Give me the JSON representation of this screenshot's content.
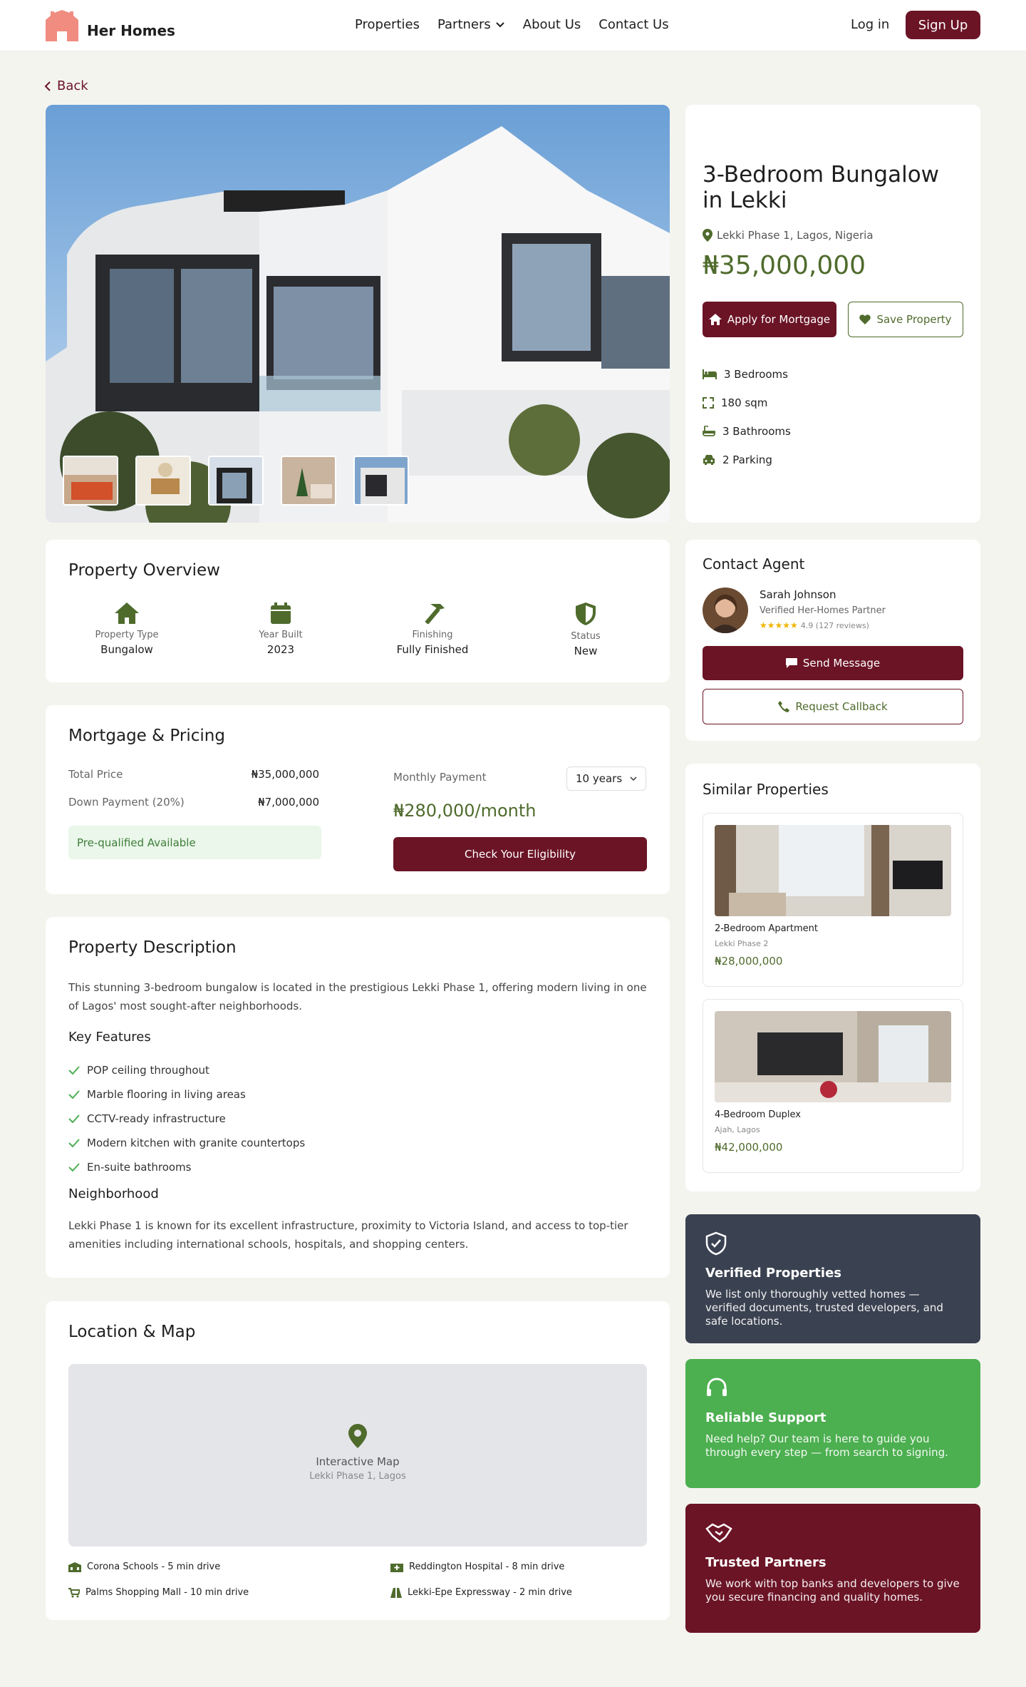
{
  "header": {
    "brand": "Her Homes",
    "nav": [
      "Properties",
      "Partners",
      "About Us",
      "Contact Us"
    ],
    "login": "Log in",
    "signup": "Sign Up"
  },
  "back": "Back",
  "property": {
    "title": "3-Bedroom Bungalow in Lekki",
    "location": "Lekki Phase 1, Lagos, Nigeria",
    "price": "₦35,000,000",
    "apply_btn": "Apply for Mortgage",
    "save_btn": "Save Property",
    "specs": [
      "3 Bedrooms",
      "180 sqm",
      "3 Bathrooms",
      "2 Parking"
    ]
  },
  "overview": {
    "heading": "Property Overview",
    "items": [
      {
        "label": "Property Type",
        "value": "Bungalow",
        "icon": "house-icon"
      },
      {
        "label": "Year Built",
        "value": "2023",
        "icon": "calendar-icon"
      },
      {
        "label": "Finishing",
        "value": "Fully Finished",
        "icon": "hammer-icon"
      },
      {
        "label": "Status",
        "value": "New",
        "icon": "shield-icon"
      }
    ]
  },
  "mortgage": {
    "heading": "Mortgage & Pricing",
    "total_label": "Total Price",
    "total_value": "₦35,000,000",
    "down_label": "Down Payment (20%)",
    "down_value": "₦7,000,000",
    "prequal": "Pre-qualified Available",
    "monthly_label": "Monthly Payment",
    "term": "10 years",
    "monthly_value": "₦280,000/month",
    "eligibility_btn": "Check Your Eligibility"
  },
  "description": {
    "heading": "Property Description",
    "text": "This stunning 3-bedroom bungalow is located in the prestigious Lekki Phase 1, offering modern living in one of Lagos' most sought-after neighborhoods.",
    "features_heading": "Key Features",
    "features": [
      "POP ceiling throughout",
      "Marble flooring in living areas",
      "CCTV-ready infrastructure",
      "Modern kitchen with granite countertops",
      "En-suite bathrooms"
    ],
    "neighborhood_heading": "Neighborhood",
    "neighborhood_text": "Lekki Phase 1 is known for its excellent infrastructure, proximity to Victoria Island, and access to top-tier amenities including international schools, hospitals, and shopping centers."
  },
  "location": {
    "heading": "Location & Map",
    "map_title": "Interactive Map",
    "map_sub": "Lekki Phase 1, Lagos",
    "nearby": [
      "Corona Schools - 5 min drive",
      "Reddington Hospital - 8 min drive",
      "Palms Shopping Mall - 10 min drive",
      "Lekki-Epe Expressway - 2 min drive"
    ]
  },
  "agent": {
    "heading": "Contact Agent",
    "name": "Sarah Johnson",
    "role": "Verified Her-Homes Partner",
    "stars": "★★★★★",
    "rating": "4.9 (127 reviews)",
    "message_btn": "Send Message",
    "callback_btn": "Request Callback"
  },
  "similar": {
    "heading": "Similar Properties",
    "items": [
      {
        "name": "2-Bedroom Apartment",
        "location": "Lekki Phase 2",
        "price": "₦28,000,000"
      },
      {
        "name": "4-Bedroom Duplex",
        "location": "Ajah, Lagos",
        "price": "₦42,000,000"
      }
    ]
  },
  "promos": [
    {
      "title": "Verified Properties",
      "text": "We list only thoroughly vetted homes — verified documents, trusted developers, and safe locations.",
      "color": "#3a4150"
    },
    {
      "title": "Reliable Support",
      "text": "Need help? Our team is here to guide you through every step — from search to signing.",
      "color": "#4caf50"
    },
    {
      "title": "Trusted Partners",
      "text": "We work with top banks and developers to give you secure financing and quality homes.",
      "color": "#6b1426"
    }
  ],
  "colors": {
    "primary": "#6b1426",
    "accent": "#4f6b2c",
    "background": "#f4f4ef"
  }
}
